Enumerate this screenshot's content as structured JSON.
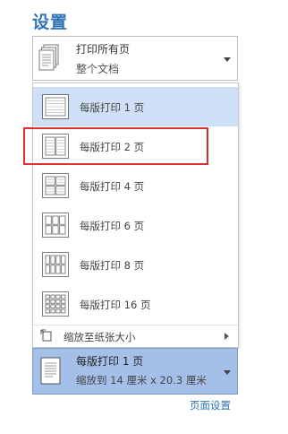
{
  "settings": {
    "title": "设置"
  },
  "scope_dropdown": {
    "line1": "打印所有页",
    "line2": "整个文档"
  },
  "menu": {
    "items": [
      {
        "label": "每版打印 1 页",
        "selected": true,
        "cols": 1,
        "rows": 1
      },
      {
        "label": "每版打印 2 页",
        "selected": false,
        "cols": 2,
        "rows": 1
      },
      {
        "label": "每版打印 4 页",
        "selected": false,
        "cols": 2,
        "rows": 2
      },
      {
        "label": "每版打印 6 页",
        "selected": false,
        "cols": 3,
        "rows": 2
      },
      {
        "label": "每版打印 8 页",
        "selected": false,
        "cols": 4,
        "rows": 2
      },
      {
        "label": "每版打印 16 页",
        "selected": false,
        "cols": 4,
        "rows": 4
      }
    ],
    "scale_label": "缩放至纸张大小"
  },
  "pages_dropdown": {
    "line1": "每版打印 1 页",
    "line2": "缩放到 14 厘米 x 20.3 厘米"
  },
  "page_setup_link": "页面设置",
  "colors": {
    "accent": "#2e74b5",
    "selected_bg": "#cfdff5",
    "dropdown_bg": "#a5c0e8",
    "highlight": "#e0302c"
  }
}
